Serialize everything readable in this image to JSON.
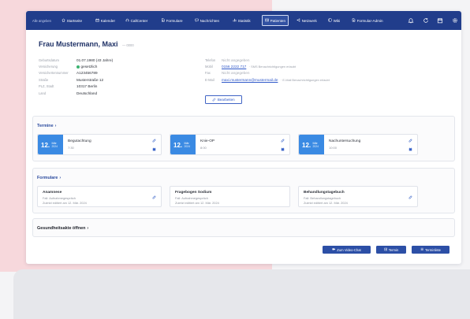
{
  "nav": {
    "items": [
      {
        "label": "Alle angeben",
        "icon": "none"
      },
      {
        "label": "Startseite",
        "icon": "home-icon"
      },
      {
        "label": "Kalender",
        "icon": "calendar-icon"
      },
      {
        "label": "CallCenter",
        "icon": "headset-icon"
      },
      {
        "label": "Formulare",
        "icon": "form-icon"
      },
      {
        "label": "Nachrichten",
        "icon": "message-icon"
      },
      {
        "label": "Statistik",
        "icon": "chart-icon"
      },
      {
        "label": "Patienten",
        "icon": "patient-card-icon",
        "active": true
      },
      {
        "label": "Netzwerk",
        "icon": "network-icon"
      },
      {
        "label": "Wiki",
        "icon": "wiki-icon"
      },
      {
        "label": "Formular-Admin",
        "icon": "form-admin-icon"
      }
    ],
    "right_icons": [
      "bell-icon",
      "sync-icon",
      "calendar-icon",
      "gear-icon"
    ]
  },
  "patient": {
    "name": "Frau Mustermann, Maxi",
    "id_suffix": "— 0000",
    "details_left": [
      {
        "label": "Geburtsdatum",
        "value": "01.07.1980 (43 Jahre)"
      },
      {
        "label": "Versicherung",
        "value": "gesetzlich"
      },
      {
        "label": "Versichertennummer",
        "value": "A123456789"
      },
      {
        "label": "Straße",
        "value": "Musterstraße 12"
      },
      {
        "label": "PLZ, Stadt",
        "value": "10317 Berlin"
      },
      {
        "label": "Land",
        "value": "Deutschland"
      }
    ],
    "details_right": [
      {
        "label": "Telefon",
        "value": "Nicht angegeben"
      },
      {
        "label": "Mobil",
        "value": "0156 2222 717",
        "note": "· SMS Benachrichtigungen erlaubt"
      },
      {
        "label": "Fax",
        "value": "Nicht angegeben"
      },
      {
        "label": "E-Mail",
        "value": "maxi.mustermann@mustermail.de",
        "note": "· E-Mail Benachrichtigungen erlaubt"
      }
    ],
    "edit_label": "Bearbeiten"
  },
  "appointments": {
    "title": "Termine",
    "items": [
      {
        "day": "12.",
        "month": "Mär",
        "year": "2024",
        "title": "Begutachtung",
        "time": "7:30"
      },
      {
        "day": "12.",
        "month": "Mär",
        "year": "2024",
        "title": "Knie-OP",
        "time": "8:00"
      },
      {
        "day": "12.",
        "month": "Mär",
        "year": "2024",
        "title": "Nachuntersuchung",
        "time": "10:00"
      }
    ]
  },
  "forms": {
    "title": "Formulare",
    "items": [
      {
        "title": "Anamnese",
        "case": "Fall: Aufnahmegespräch",
        "edited": "Zuletzt editiert am 12. Mär. 2024"
      },
      {
        "title": "Fragebogen Sodium",
        "case": "Fall: Aufnahmegespräch",
        "edited": "Zuletzt editiert am 12. Mär. 2024"
      },
      {
        "title": "Behandlungstagebuch",
        "case": "Fall: Behandlungstagebuch",
        "edited": "Zuletzt editiert am 12. Mär. 2024"
      }
    ]
  },
  "health_record": {
    "label": "Gesundheitsakte öffnen"
  },
  "actions": {
    "video_chat": "Zum Video-Chat",
    "appointment": "Termin",
    "appointment_list": "Terminliste"
  },
  "colors": {
    "nav": "#213d8b",
    "accent": "#2f58c9",
    "date_block": "#3a8ae3",
    "status_insured": "#3cb371",
    "backdrop": "#f7d8dc"
  }
}
